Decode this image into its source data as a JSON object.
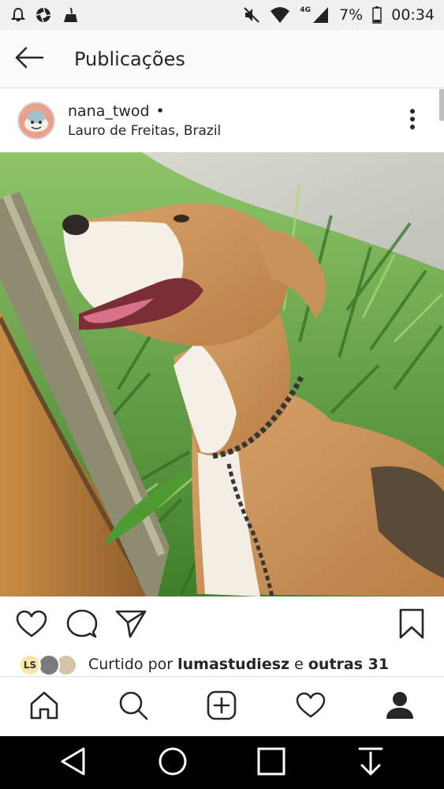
{
  "status_bar": {
    "network_label": "4G",
    "battery_percent": "7%",
    "time": "00:34",
    "icons": [
      "alarm-icon",
      "aperture-icon",
      "broom-icon",
      "mute-icon",
      "wifi-icon",
      "signal-icon",
      "battery-icon"
    ]
  },
  "header": {
    "title": "Publicações",
    "back_icon": "arrow-left-icon"
  },
  "post": {
    "username": "nana_twod",
    "separator": "•",
    "location": "Lauro de Freitas, Brazil",
    "more_icon": "more-vertical-icon"
  },
  "actions": {
    "icons": [
      "heart-icon",
      "comment-icon",
      "share-icon",
      "bookmark-icon"
    ]
  },
  "likes": {
    "prefix": "Curtido por",
    "user": "lumastudiesz",
    "connector": "e",
    "others": "outras 31",
    "avatar_initials": "LS"
  },
  "bottom_nav": {
    "items": [
      "home-icon",
      "search-icon",
      "add-post-icon",
      "activity-heart-icon",
      "profile-icon"
    ],
    "active": "profile-icon"
  },
  "system_nav": {
    "items": [
      "back-triangle-icon",
      "home-circle-icon",
      "recents-square-icon",
      "download-arrow-icon"
    ]
  },
  "colors": {
    "status_bar_bg": "#f0f0f0",
    "app_bar_bg": "#fafafa",
    "text": "#262626",
    "divider": "#dbdbdb",
    "system_nav_bg": "#000000"
  }
}
